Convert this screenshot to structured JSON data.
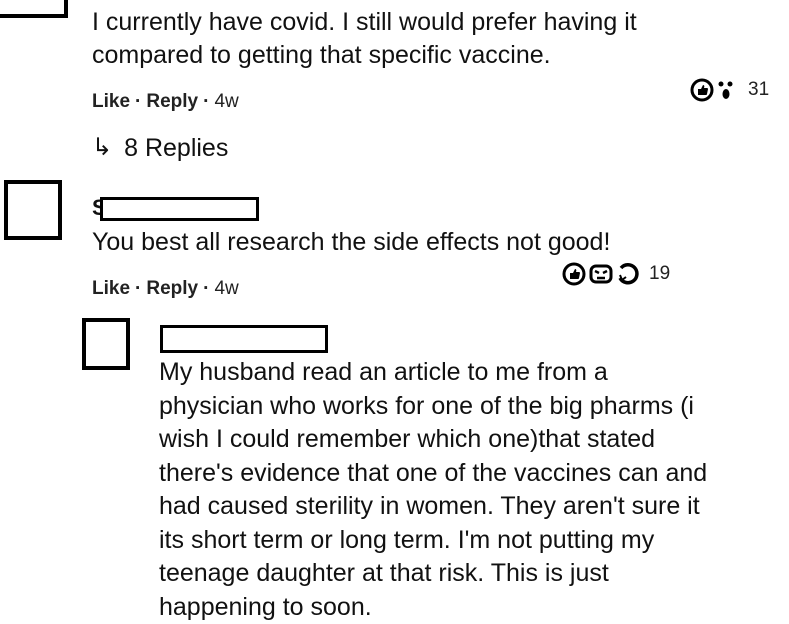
{
  "comments": [
    {
      "lines": [
        "I currently have covid. I still would prefer having it",
        "compared to getting that specific vaccine."
      ],
      "actions": {
        "like": "Like",
        "reply": "Reply",
        "separator": "·",
        "time": "4w"
      },
      "reactions": {
        "icons": [
          "like-icon",
          "wow-icon"
        ],
        "count": "31"
      },
      "replies_label": "8 Replies"
    },
    {
      "name_initial": "S",
      "lines": [
        "You best all research the side effects not good!"
      ],
      "actions": {
        "like": "Like",
        "reply": "Reply",
        "separator": "·",
        "time": "4w"
      },
      "reactions": {
        "icons": [
          "like-icon",
          "angry-icon",
          "care-icon"
        ],
        "count": "19"
      }
    },
    {
      "lines": [
        "My husband read an article to me from a",
        "physician who works for one of the big pharms (i",
        "wish I could remember which one)that stated",
        "there's evidence that one of the vaccines can and",
        "had caused sterility in women. They aren't sure it",
        "its short term or long term. I'm not putting my",
        "teenage daughter at that risk. This is just",
        "happening to soon."
      ]
    }
  ]
}
